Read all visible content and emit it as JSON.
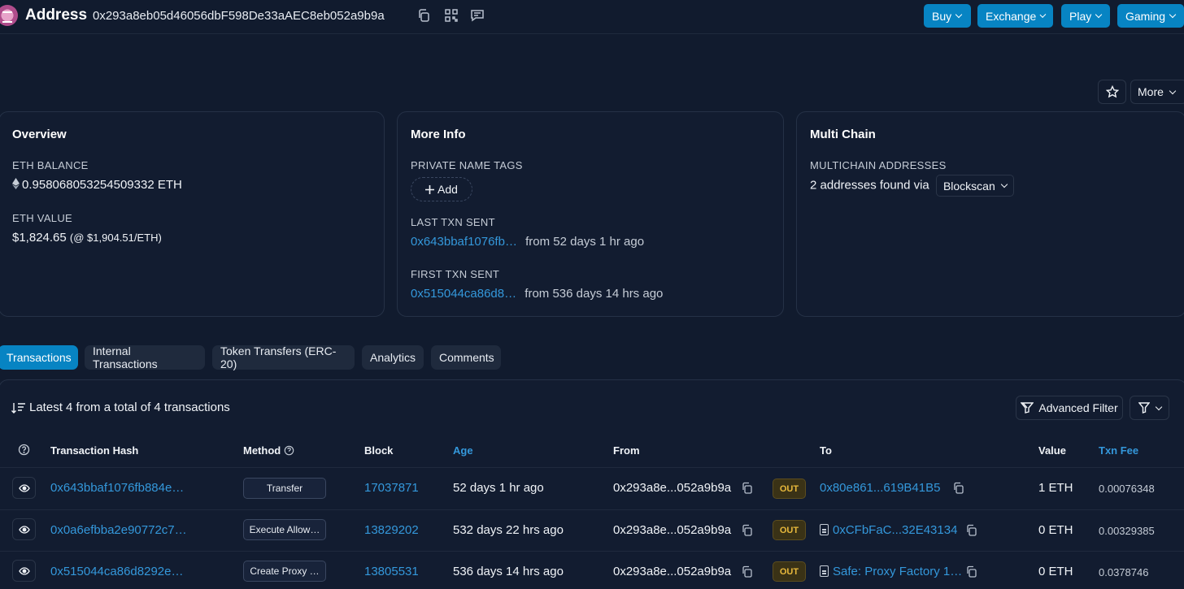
{
  "header": {
    "title": "Address",
    "address": "0x293a8eb05d46056dbF598De33aAEC8eb052a9b9a",
    "nav": [
      {
        "label": "Buy"
      },
      {
        "label": "Exchange"
      },
      {
        "label": "Play"
      },
      {
        "label": "Gaming"
      }
    ],
    "more_label": "More"
  },
  "overview": {
    "title": "Overview",
    "eth_balance_label": "ETH BALANCE",
    "eth_balance": "0.958068053254509332 ETH",
    "eth_value_label": "ETH VALUE",
    "eth_value": "$1,824.65",
    "eth_price": "(@ $1,904.51/ETH)"
  },
  "more_info": {
    "title": "More Info",
    "private_tags_label": "PRIVATE NAME TAGS",
    "add_label": "Add",
    "last_txn_label": "LAST TXN SENT",
    "last_txn_hash": "0x643bbaf1076fb…",
    "last_txn_age": "from 52 days 1 hr ago",
    "first_txn_label": "FIRST TXN SENT",
    "first_txn_hash": "0x515044ca86d8…",
    "first_txn_age": "from 536 days 14 hrs ago"
  },
  "multi_chain": {
    "title": "Multi Chain",
    "addresses_label": "MULTICHAIN ADDRESSES",
    "found_text": "2 addresses found via",
    "source": "Blockscan"
  },
  "tabs": [
    {
      "label": "Transactions",
      "active": true
    },
    {
      "label": "Internal Transactions"
    },
    {
      "label": "Token Transfers (ERC-20)"
    },
    {
      "label": "Analytics"
    },
    {
      "label": "Comments"
    }
  ],
  "table": {
    "summary": "Latest 4 from a total of 4 transactions",
    "advanced_filter_label": "Advanced Filter",
    "columns": {
      "hash": "Transaction Hash",
      "method": "Method",
      "block": "Block",
      "age": "Age",
      "from": "From",
      "to": "To",
      "value": "Value",
      "fee": "Txn Fee"
    },
    "rows": [
      {
        "hash": "0x643bbaf1076fb884e…",
        "method": "Transfer",
        "block": "17037871",
        "age": "52 days 1 hr ago",
        "from": "0x293a8e...052a9b9a",
        "direction": "OUT",
        "to": "0x80e861...619B41B5",
        "value": "1 ETH",
        "fee": "0.00076348"
      },
      {
        "hash": "0x0a6efbba2e90772c7…",
        "method": "Execute Allow…",
        "block": "13829202",
        "age": "532 days 22 hrs ago",
        "from": "0x293a8e...052a9b9a",
        "direction": "OUT",
        "to": "0xCFbFaC...32E43134",
        "value": "0 ETH",
        "fee": "0.00329385"
      },
      {
        "hash": "0x515044ca86d8292e…",
        "method": "Create Proxy …",
        "block": "13805531",
        "age": "536 days 14 hrs ago",
        "from": "0x293a8e...052a9b9a",
        "direction": "OUT",
        "to": "Safe: Proxy Factory 1…",
        "value": "0 ETH",
        "fee": "0.0378746"
      }
    ]
  },
  "colors": {
    "background": "#111b2e",
    "accent": "#0784c3",
    "link": "#3498db",
    "out_badge": "#e8b93c"
  }
}
